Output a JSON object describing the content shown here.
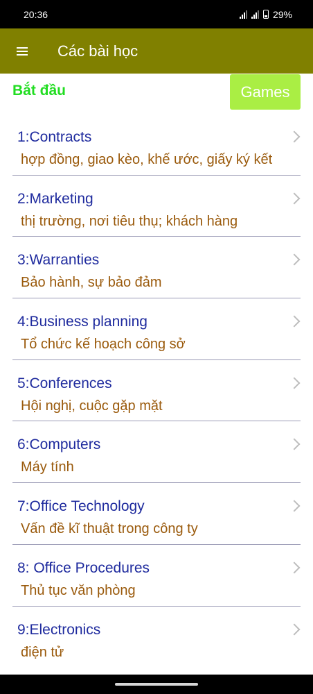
{
  "status": {
    "time": "20:36",
    "battery": "29%"
  },
  "app_bar": {
    "title": "Các bài học"
  },
  "header": {
    "start_label": "Bắt đầu",
    "games_label": "Games"
  },
  "lessons": [
    {
      "title": "1:Contracts",
      "subtitle": "hợp đồng, giao kèo, khế ước, giấy ký kết"
    },
    {
      "title": "2:Marketing",
      "subtitle": "thị trường, nơi tiêu thụ; khách hàng"
    },
    {
      "title": "3:Warranties",
      "subtitle": "Bảo hành, sự bảo đảm"
    },
    {
      "title": "4:Business planning",
      "subtitle": "Tổ chức kế hoạch công sở"
    },
    {
      "title": "5:Conferences",
      "subtitle": "Hội nghị, cuộc gặp mặt"
    },
    {
      "title": "6:Computers",
      "subtitle": "Máy tính"
    },
    {
      "title": "7:Office Technology",
      "subtitle": "Vấn đề kĩ thuật trong công ty"
    },
    {
      "title": "8: Office Procedures",
      "subtitle": "Thủ tục văn  phòng"
    },
    {
      "title": "9:Electronics",
      "subtitle": "điện tử"
    }
  ],
  "colors": {
    "app_bar": "#808000",
    "games_button": "#aaee44",
    "start_label": "#22dd22",
    "lesson_title": "#1f2b9e",
    "lesson_subtitle": "#9a5a0c"
  }
}
